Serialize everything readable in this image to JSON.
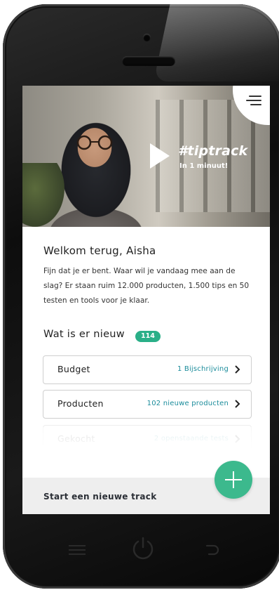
{
  "hero": {
    "brand": "#tiptrack",
    "brand_sub": "In 1 minuut!"
  },
  "welcome": {
    "title": "Welkom terug, Aisha",
    "intro": "Fijn dat je er bent. Waar wil je vandaag mee aan de slag? Er staan ruim 12.000 producten, 1.500 tips en 50 testen en tools voor je klaar."
  },
  "news": {
    "title": "Wat is er nieuw",
    "badge": "114",
    "items": [
      {
        "label": "Budget",
        "value": "1 Bijschrijving"
      },
      {
        "label": "Producten",
        "value": "102 nieuwe producten"
      },
      {
        "label": "Gekocht",
        "value": "2 openstaande tests"
      }
    ]
  },
  "footer": {
    "label": "Start een nieuwe track"
  },
  "colors": {
    "accent": "#3cb98d",
    "badge": "#2aaf88",
    "link": "#1b8c9b"
  }
}
